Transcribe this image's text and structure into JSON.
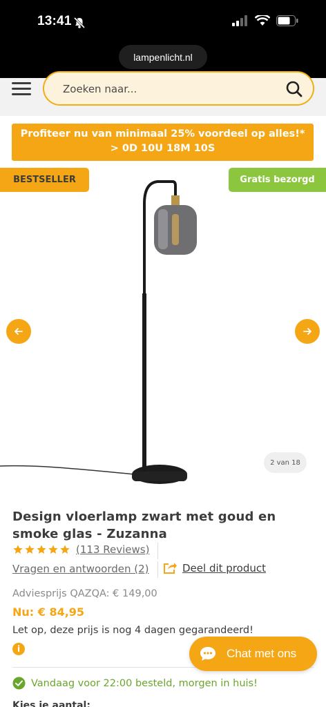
{
  "status_bar": {
    "time": "13:41"
  },
  "browser": {
    "url": "lampenlicht.nl"
  },
  "header": {
    "search_placeholder": "Zoeken naar..."
  },
  "promo": {
    "line1": "Profiteer nu van minimaal 25% voordeel op alles!*",
    "line2": "> 0D 10U 18M 10S"
  },
  "gallery": {
    "badge_left": "BESTSELLER",
    "badge_right": "Gratis bezorgd",
    "counter": "2 van 18"
  },
  "product": {
    "title": "Design vloerlamp zwart met goud en smoke glas - Zuzanna",
    "rating_stars": 5,
    "reviews_link": "(113 Reviews)",
    "qa_link": "Vragen en antwoorden (2)",
    "share_label": "Deel dit product",
    "advice_price": "Adviesprijs QAZQA: € 149,00",
    "price": "Nu: € 84,95",
    "guarantee": "Let op, deze prijs is nog 4 dagen gegarandeerd!",
    "delivery": "Vandaag voor 22:00 besteld, morgen in huis!",
    "cutoff_text": "Kies je aantal:"
  },
  "chat": {
    "label": "Chat met ons"
  },
  "colors": {
    "accent": "#f5a615",
    "green": "#8cc63f",
    "delivery_green": "#6aa52d"
  }
}
